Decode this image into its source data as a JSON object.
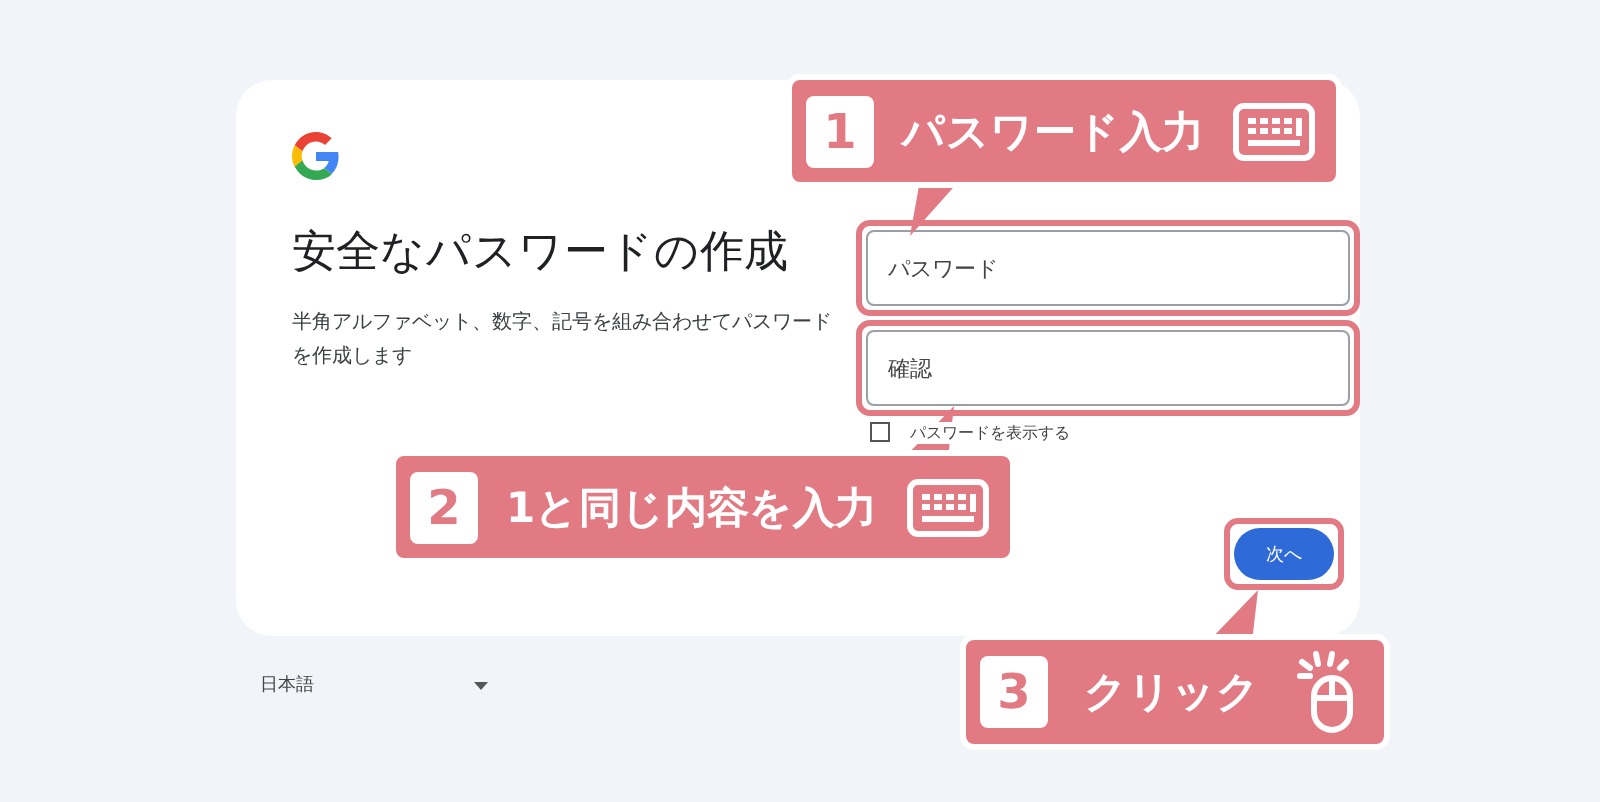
{
  "page": {
    "title": "安全なパスワードの作成",
    "description": "半角アルファベット、数字、記号を組み合わせてパスワードを作成します"
  },
  "fields": [
    {
      "placeholder": "パスワード",
      "highlighted": true
    },
    {
      "placeholder": "確認",
      "highlighted": true
    }
  ],
  "show_password": {
    "label": "パスワードを表示する",
    "checked": false
  },
  "next_button": {
    "label": "次へ",
    "highlighted": true
  },
  "language": {
    "value": "日本語"
  },
  "callouts": [
    {
      "number": "1",
      "text": "パスワード入力",
      "kind": "keyboard"
    },
    {
      "number": "2",
      "text": "1と同じ内容を入力",
      "kind": "keyboard"
    },
    {
      "number": "3",
      "text": "クリック",
      "kind": "mouse"
    }
  ]
}
